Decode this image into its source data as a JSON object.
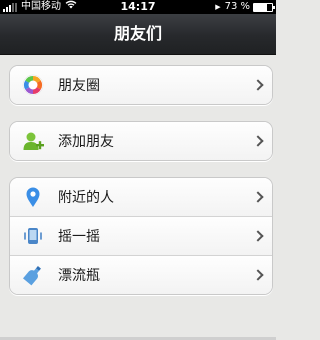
{
  "status_bar": {
    "carrier": "中国移动",
    "time": "14:17",
    "battery_percent": "73 %",
    "battery_level": 0.73
  },
  "nav": {
    "title": "朋友们"
  },
  "groups": [
    {
      "items": [
        {
          "label": "朋友圈",
          "icon": "moments-icon"
        }
      ]
    },
    {
      "items": [
        {
          "label": "添加朋友",
          "icon": "add-friend-icon"
        }
      ]
    },
    {
      "items": [
        {
          "label": "附近的人",
          "icon": "location-pin-icon"
        },
        {
          "label": "摇一摇",
          "icon": "shake-icon"
        },
        {
          "label": "漂流瓶",
          "icon": "bottle-icon"
        }
      ]
    }
  ]
}
